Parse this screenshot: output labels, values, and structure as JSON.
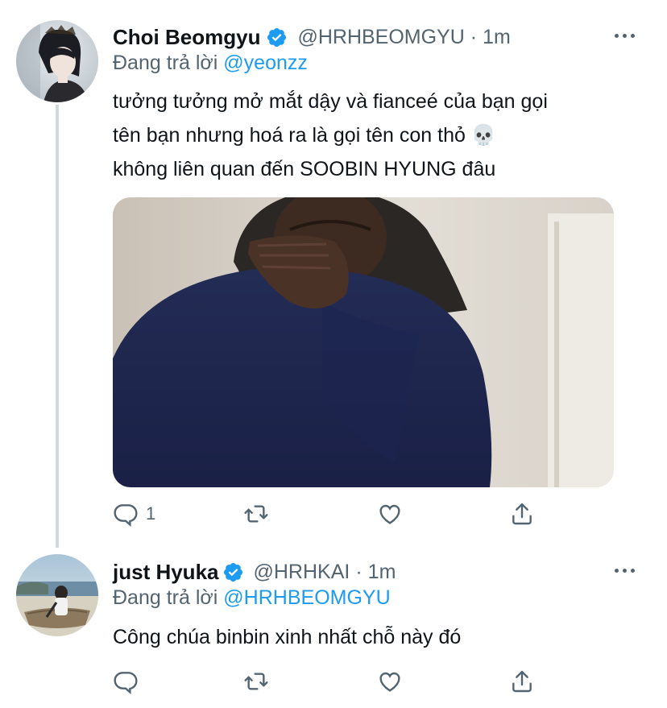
{
  "tweets": [
    {
      "display_name": "Choi Beomgyu",
      "handle": "@HRHBEOMGYU",
      "separator": "·",
      "time": "1m",
      "reply_prefix": "Đang trả lời",
      "reply_mention": "@yeonzz",
      "text_lines": [
        "tưởng tưởng mở mắt dậy và fianceé của bạn gọi",
        "tên bạn nhưng hoá ra là gọi tên con thỏ 💀",
        "không liên quan đến SOOBIN HYUNG đâu"
      ],
      "reply_count": "1",
      "has_media": true
    },
    {
      "display_name": "just Hyuka",
      "handle": "@HRHKAI",
      "separator": "·",
      "time": "1m",
      "reply_prefix": "Đang trả lời",
      "reply_mention": "@HRHBEOMGYU",
      "text_lines": [
        "Công chúa binbin xinh nhất chỗ này đó"
      ],
      "reply_count": "",
      "has_media": false
    }
  ],
  "icons": {
    "verified": "verified-badge-icon",
    "more": "more-dots-icon",
    "reply": "reply-icon",
    "retweet": "retweet-icon",
    "like": "like-icon",
    "share": "share-icon"
  },
  "colors": {
    "accent": "#1d9bf0",
    "text": "#0f1419",
    "muted": "#536471",
    "thread_line": "#cfd9de"
  }
}
